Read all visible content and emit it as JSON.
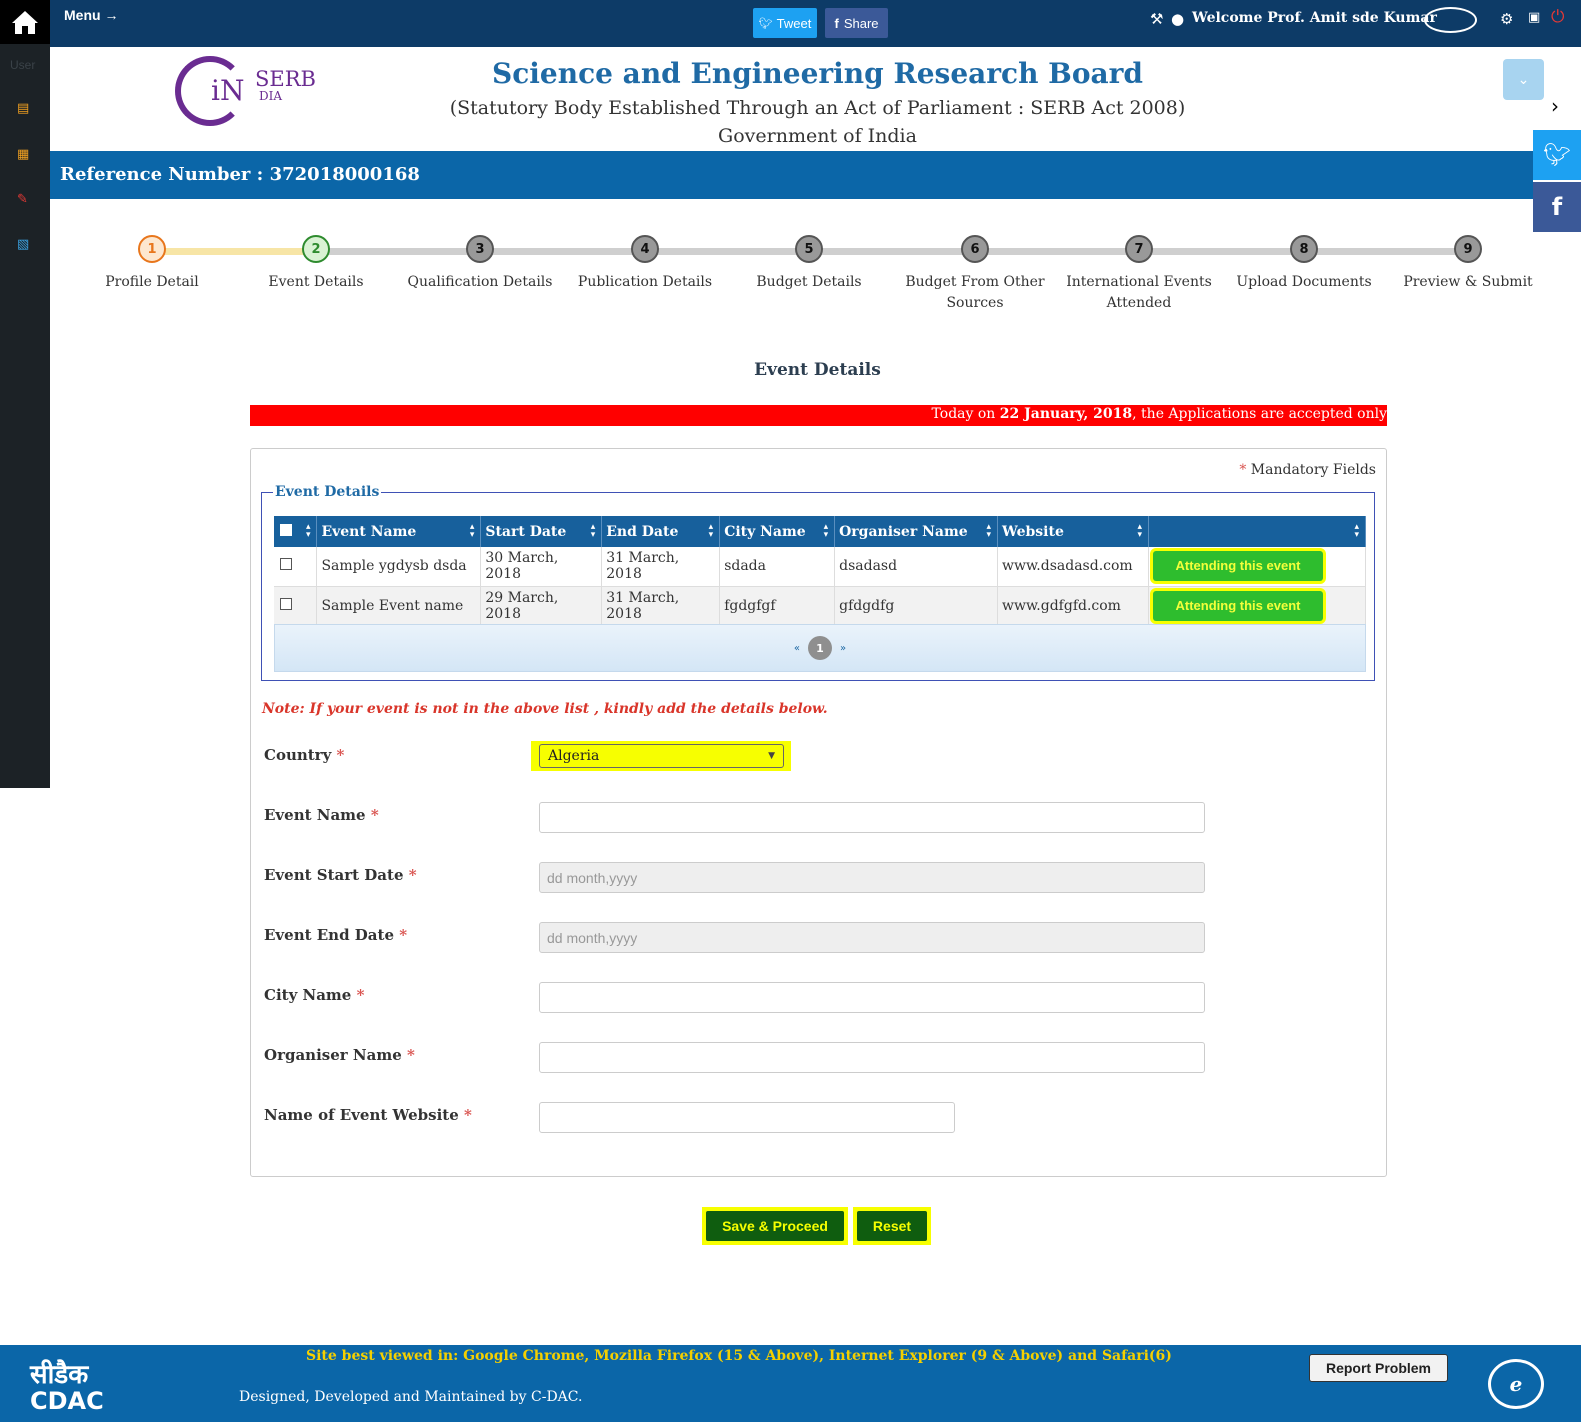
{
  "topbar": {
    "menu_label": "Menu",
    "tweet_label": "Tweet",
    "share_label": "Share",
    "welcome": "Welcome Prof. Amit sde Kumar"
  },
  "sidebar": {
    "user_label": "User"
  },
  "header": {
    "title": "Science and Engineering Research Board",
    "subtitle": "(Statutory Body Established Through an Act of Parliament : SERB Act 2008)",
    "government": "Government of India",
    "logo_serb": "SERB",
    "logo_in": "iN",
    "logo_dia": "DIA"
  },
  "reference": {
    "text": "Reference Number : 372018000168"
  },
  "steps": [
    {
      "num": "1",
      "label": "Profile Detail"
    },
    {
      "num": "2",
      "label": "Event Details"
    },
    {
      "num": "3",
      "label": "Qualification Details"
    },
    {
      "num": "4",
      "label": "Publication Details"
    },
    {
      "num": "5",
      "label": "Budget Details"
    },
    {
      "num": "6",
      "label": "Budget From Other Sources"
    },
    {
      "num": "7",
      "label": "International Events Attended"
    },
    {
      "num": "8",
      "label": "Upload Documents"
    },
    {
      "num": "9",
      "label": "Preview & Submit"
    }
  ],
  "main": {
    "section_title": "Event Details",
    "marquee_pre": "Today on ",
    "marquee_date": "22 January, 2018",
    "marquee_post": ", the Applications are accepted only",
    "mandatory": "Mandatory Fields",
    "fieldset_legend": "Event Details",
    "note": "Note: If your event is not in the above list , kindly add the details below."
  },
  "table": {
    "headers": [
      "Event Name",
      "Start Date",
      "End Date",
      "City Name",
      "Organiser Name",
      "Website",
      ""
    ],
    "rows": [
      {
        "event": "Sample ygdysb dsda",
        "start": "30 March, 2018",
        "end": "31 March, 2018",
        "city": "sdada",
        "organiser": "dsadasd",
        "website": "www.dsadasd.com",
        "action": "Attending this event"
      },
      {
        "event": "Sample Event name",
        "start": "29 March, 2018",
        "end": "31 March, 2018",
        "city": "fgdgfgf",
        "organiser": "gfdgdfg",
        "website": "www.gdfgfd.com",
        "action": "Attending this event"
      }
    ],
    "pager": {
      "prev": "«",
      "page": "1",
      "next": "»"
    }
  },
  "form": {
    "country_label": "Country",
    "country_value": "Algeria",
    "event_name_label": "Event Name",
    "start_date_label": "Event Start Date",
    "start_date_placeholder": "dd month,yyyy",
    "end_date_label": "Event End Date",
    "end_date_placeholder": "dd month,yyyy",
    "city_label": "City Name",
    "organiser_label": "Organiser Name",
    "website_label": "Name of Event Website",
    "required_mark": "*"
  },
  "actions": {
    "save_label": "Save & Proceed",
    "reset_label": "Reset"
  },
  "footer": {
    "cdac_hindi": "सीडैक",
    "cdac_english": "CDAC",
    "best_viewed": "Site best viewed in: Google Chrome, Mozilla Firefox (15 & Above), Internet Explorer (9 & Above) and Safari(6)",
    "designed": "Designed, Developed and Maintained by C-DAC.",
    "report_label": "Report Problem",
    "epms": "e"
  },
  "colors": {
    "topbar": "#0d3b67",
    "ref_bar": "#0b66a8",
    "title_blue": "#1f6aa5",
    "highlight": "#f7ff00",
    "attend_green": "#2ebd2e",
    "required_red": "#d9534f"
  }
}
